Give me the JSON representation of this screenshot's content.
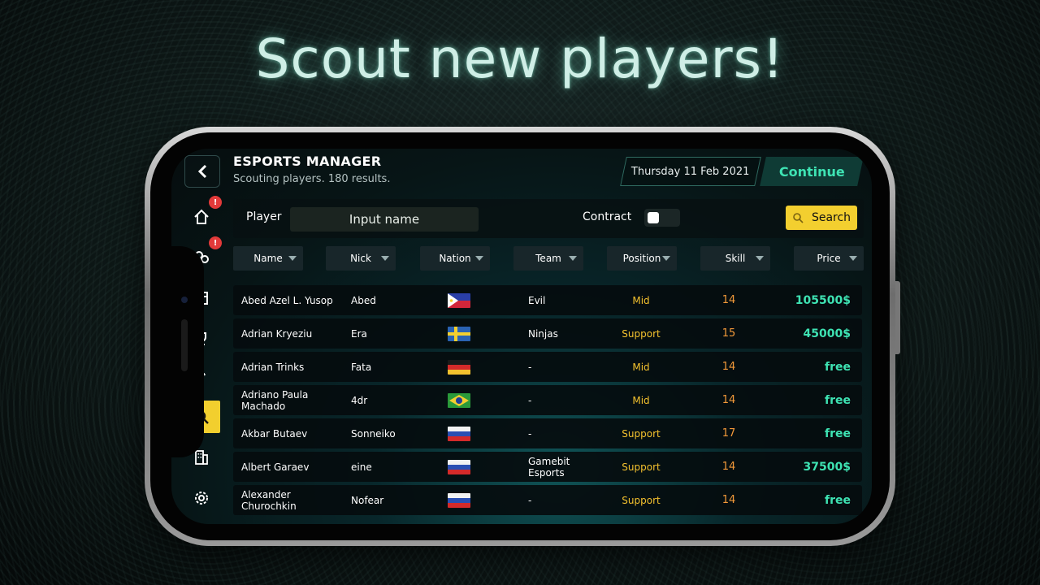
{
  "headline": "Scout new players!",
  "app": {
    "title": "ESPORTS MANAGER",
    "subtitle": "Scouting players. 180 results.",
    "date": "Thursday 11 Feb 2021",
    "continue_label": "Continue"
  },
  "sidebar": {
    "items": [
      {
        "icon": "home-icon",
        "badge": "!"
      },
      {
        "icon": "team-icon",
        "badge": "!"
      },
      {
        "icon": "calendar-icon",
        "badge": ""
      },
      {
        "icon": "trophy-icon",
        "badge": ""
      },
      {
        "icon": "stats-icon",
        "badge": ""
      },
      {
        "icon": "scout-icon",
        "badge": "",
        "active": true
      },
      {
        "icon": "building-icon",
        "badge": ""
      },
      {
        "icon": "settings-icon",
        "badge": ""
      }
    ]
  },
  "filters": {
    "player_label": "Player",
    "player_placeholder": "Input name",
    "contract_label": "Contract",
    "contract_on": false,
    "search_label": "Search"
  },
  "columns": [
    "Name",
    "Nick",
    "Nation",
    "Team",
    "Position",
    "Skill",
    "Price"
  ],
  "rows": [
    {
      "name": "Abed Azel L. Yusop",
      "nick": "Abed",
      "nation": "philippines",
      "team": "Evil",
      "position": "Mid",
      "skill": "14",
      "price": "105500$"
    },
    {
      "name": "Adrian Kryeziu",
      "nick": "Era",
      "nation": "sweden",
      "team": "Ninjas",
      "position": "Support",
      "skill": "15",
      "price": "45000$"
    },
    {
      "name": "Adrian Trinks",
      "nick": "Fata",
      "nation": "germany",
      "team": "-",
      "position": "Mid",
      "skill": "14",
      "price": "free"
    },
    {
      "name": "Adriano Paula Machado",
      "nick": "4dr",
      "nation": "brazil",
      "team": "-",
      "position": "Mid",
      "skill": "14",
      "price": "free"
    },
    {
      "name": "Akbar Butaev",
      "nick": "Sonneiko",
      "nation": "russia",
      "team": "-",
      "position": "Support",
      "skill": "17",
      "price": "free"
    },
    {
      "name": "Albert Garaev",
      "nick": "eine",
      "nation": "russia",
      "team": "Gamebit Esports",
      "position": "Support",
      "skill": "14",
      "price": "37500$"
    },
    {
      "name": "Alexander Churochkin",
      "nick": "Nofear",
      "nation": "russia",
      "team": "-",
      "position": "Support",
      "skill": "14",
      "price": "free"
    }
  ],
  "colors": {
    "accent_green": "#3ee3b3",
    "accent_yellow": "#f3cf2f",
    "skill_orange": "#f49a3a",
    "badge_red": "#e23a3a"
  }
}
